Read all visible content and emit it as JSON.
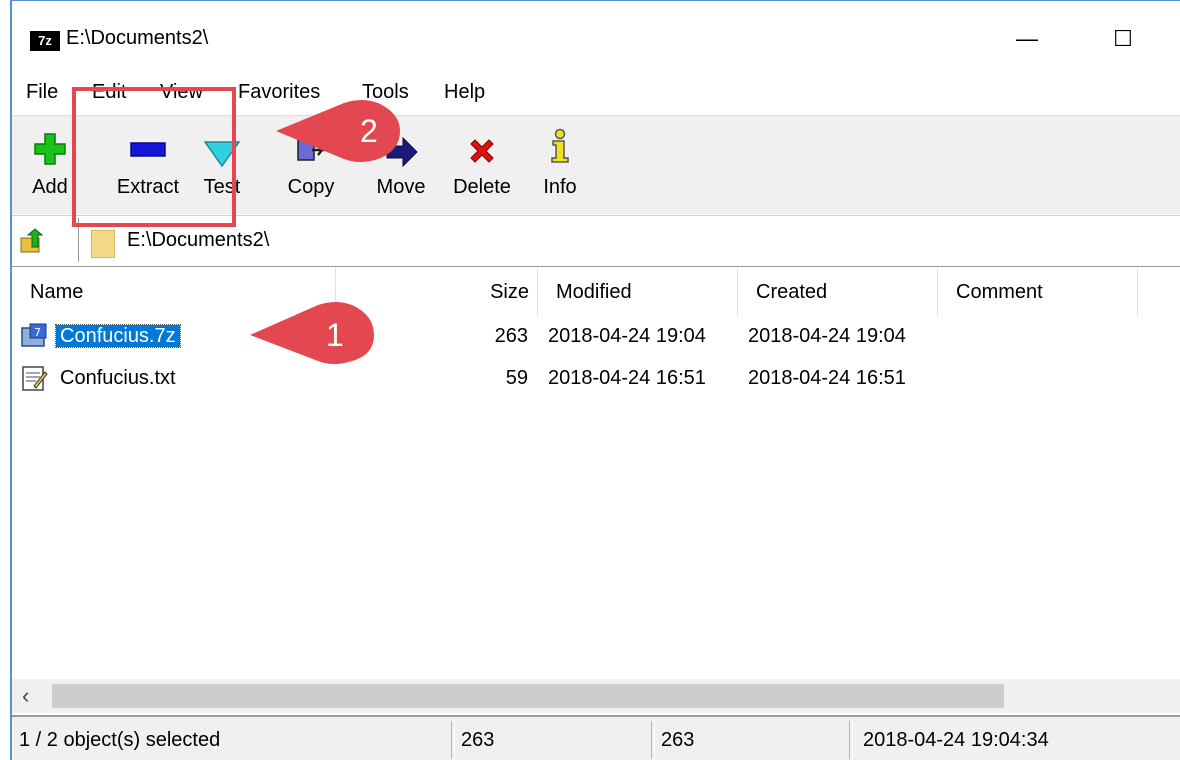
{
  "window": {
    "app_logo": "7z",
    "title": "E:\\Documents2\\",
    "minimize_glyph": "—",
    "maximize_glyph": "☐"
  },
  "menu": [
    "File",
    "Edit",
    "View",
    "Favorites",
    "Tools",
    "Help"
  ],
  "toolbar": [
    {
      "label": "Add",
      "icon": "add-icon"
    },
    {
      "label": "Extract",
      "icon": "extract-icon"
    },
    {
      "label": "Test",
      "icon": "test-icon"
    },
    {
      "label": "Copy",
      "icon": "copy-icon"
    },
    {
      "label": "Move",
      "icon": "move-icon"
    },
    {
      "label": "Delete",
      "icon": "delete-icon"
    },
    {
      "label": "Info",
      "icon": "info-icon"
    }
  ],
  "address": {
    "path": "E:\\Documents2\\"
  },
  "columns": [
    "Name",
    "Size",
    "Modified",
    "Created",
    "Comment"
  ],
  "files": [
    {
      "name": "Confucius.7z",
      "size": "263",
      "modified": "2018-04-24 19:04",
      "created": "2018-04-24 19:04",
      "comment": "",
      "selected": true,
      "icon": "archive-file-icon"
    },
    {
      "name": "Confucius.txt",
      "size": "59",
      "modified": "2018-04-24 16:51",
      "created": "2018-04-24 16:51",
      "comment": "",
      "selected": false,
      "icon": "text-file-icon"
    }
  ],
  "status": {
    "selection": "1 / 2 object(s) selected",
    "size_selected": "263",
    "size_total": "263",
    "modified": "2018-04-24 19:04:34"
  },
  "annotations": {
    "callout1": "1",
    "callout2": "2",
    "callout_color": "#e3474f",
    "highlight_color": "#e3474f"
  },
  "colors": {
    "selection": "#0078d7",
    "toolbar_bg": "#f0f0f0",
    "window_border": "#5b8fd0"
  }
}
